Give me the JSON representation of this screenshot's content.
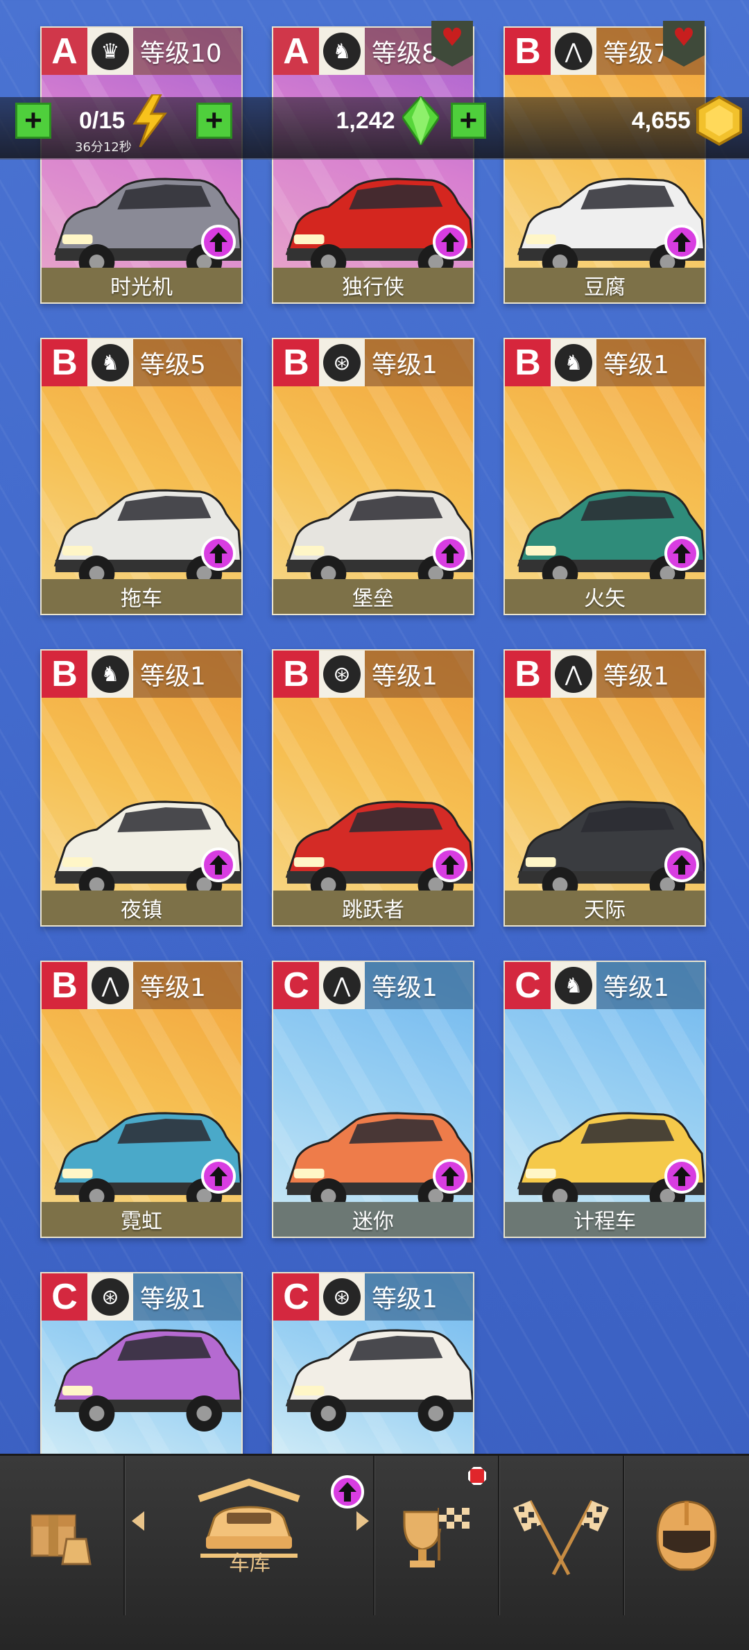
{
  "resources": {
    "energy": {
      "value": "0/15",
      "timer": "36分12秒",
      "icon": "lightning-icon"
    },
    "gems": {
      "value": "1,242",
      "icon": "green-gem-icon"
    },
    "coins": {
      "value": "4,655",
      "icon": "gold-coin-icon"
    }
  },
  "cards": [
    {
      "class": "A",
      "emblem": "crown-emblem",
      "level": "等级10",
      "name": "时光机",
      "favorite": false,
      "body_color": "#8a8a96",
      "theme": "pink"
    },
    {
      "class": "A",
      "emblem": "horse-emblem",
      "level": "等级8",
      "name": "独行侠",
      "favorite": true,
      "body_color": "#d4261f",
      "theme": "pink"
    },
    {
      "class": "B",
      "emblem": "road-emblem",
      "level": "等级7",
      "name": "豆腐",
      "favorite": true,
      "body_color": "#efefef",
      "theme": "orange"
    },
    {
      "class": "B",
      "emblem": "horse-emblem",
      "level": "等级5",
      "name": "拖车",
      "favorite": false,
      "body_color": "#e8e8e4",
      "theme": "orange"
    },
    {
      "class": "B",
      "emblem": "wheel-emblem",
      "level": "等级1",
      "name": "堡垒",
      "favorite": false,
      "body_color": "#e6e4df",
      "theme": "orange"
    },
    {
      "class": "B",
      "emblem": "horse-emblem",
      "level": "等级1",
      "name": "火矢",
      "favorite": false,
      "body_color": "#2f8c7a",
      "theme": "orange"
    },
    {
      "class": "B",
      "emblem": "horse-emblem",
      "level": "等级1",
      "name": "夜镇",
      "favorite": false,
      "body_color": "#f1efe4",
      "theme": "orange"
    },
    {
      "class": "B",
      "emblem": "wheel-emblem",
      "level": "等级1",
      "name": "跳跃者",
      "favorite": false,
      "body_color": "#d42b26",
      "theme": "orange"
    },
    {
      "class": "B",
      "emblem": "road-emblem",
      "level": "等级1",
      "name": "天际",
      "favorite": false,
      "body_color": "#3a3c40",
      "theme": "orange"
    },
    {
      "class": "B",
      "emblem": "road-emblem",
      "level": "等级1",
      "name": "霓虹",
      "favorite": false,
      "body_color": "#4aa9c9",
      "theme": "orange"
    },
    {
      "class": "C",
      "emblem": "road-emblem",
      "level": "等级1",
      "name": "迷你",
      "favorite": false,
      "body_color": "#ee7c4a",
      "theme": "blue"
    },
    {
      "class": "C",
      "emblem": "horse-emblem",
      "level": "等级1",
      "name": "计程车",
      "favorite": false,
      "body_color": "#f5c94a",
      "theme": "blue"
    },
    {
      "class": "C",
      "emblem": "wheel-emblem",
      "level": "等级1",
      "name": "",
      "favorite": false,
      "body_color": "#b56ad1",
      "theme": "blue"
    },
    {
      "class": "C",
      "emblem": "wheel-emblem",
      "level": "等级1",
      "name": "",
      "favorite": false,
      "body_color": "#f2eee6",
      "theme": "blue"
    }
  ],
  "nav": {
    "items": [
      {
        "icon": "shop-box-icon"
      },
      {
        "icon": "garage-car-icon",
        "label": "车库"
      },
      {
        "icon": "trophy-flag-icon"
      },
      {
        "icon": "checkered-flags-icon"
      },
      {
        "icon": "helmet-icon"
      }
    ]
  },
  "colors": {
    "accent_green": "#4fcf3c",
    "upgrade_purple": "#d83de1",
    "nav_label": "#e9c48a"
  }
}
